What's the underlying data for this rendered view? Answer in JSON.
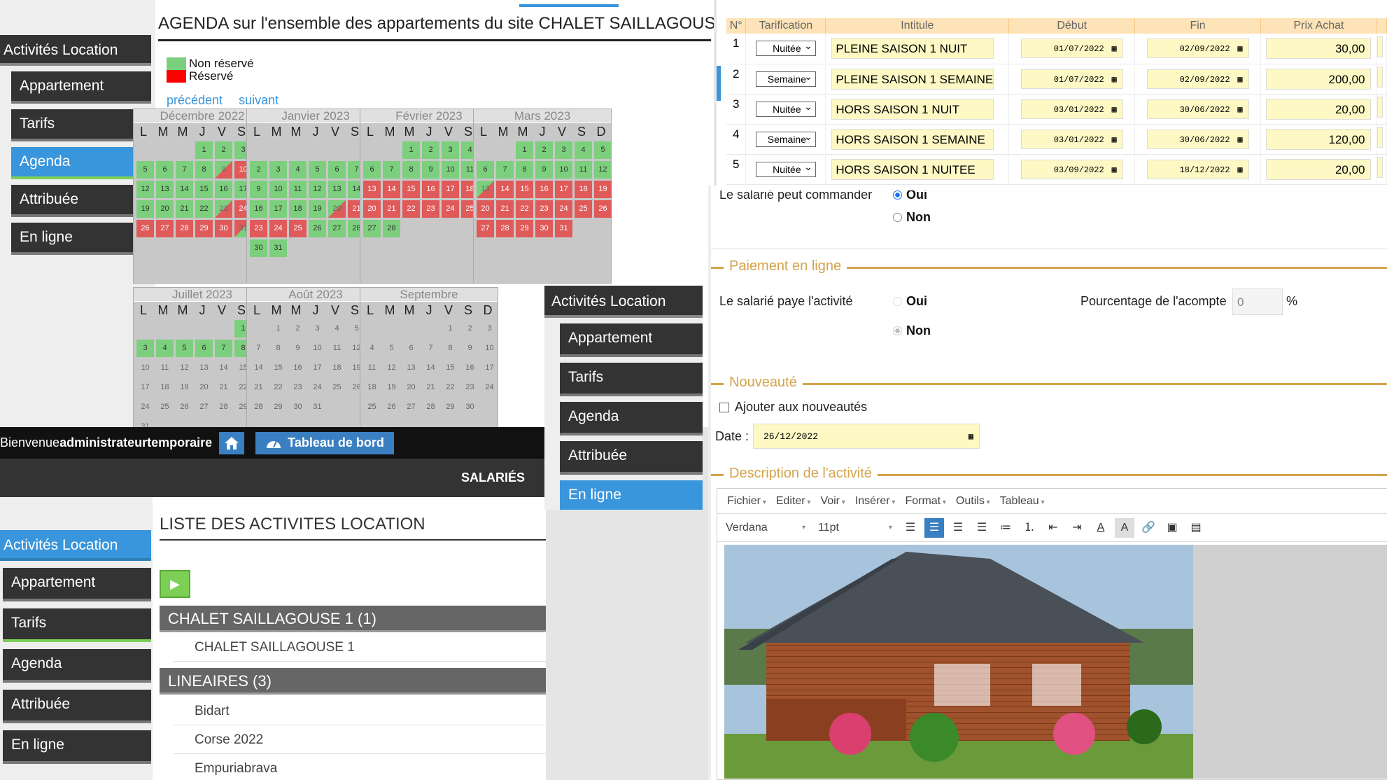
{
  "agenda": {
    "title": "AGENDA sur l'ensemble des appartements du site CHALET SAILLAGOUSE 1",
    "legend_free": "Non réservé",
    "legend_booked": "Réservé",
    "prev": "précédent",
    "next": "suivant",
    "colors": {
      "free": "#7ccf7c",
      "booked": "#e05a5a",
      "accent": "#3a96dc"
    },
    "day_headers": [
      "L",
      "M",
      "M",
      "J",
      "V",
      "S",
      "D"
    ],
    "months": [
      {
        "name": "Décembre 2022"
      },
      {
        "name": "Janvier 2023"
      },
      {
        "name": "Février 2023"
      },
      {
        "name": "Mars 2023"
      },
      {
        "name": "Juillet 2023"
      },
      {
        "name": "Août 2023"
      },
      {
        "name": "Septembre"
      }
    ]
  },
  "nav1": {
    "header": "Activités Location",
    "items": [
      "Appartement",
      "Tarifs",
      "Agenda",
      "Attribuée",
      "En ligne"
    ]
  },
  "nav2": {
    "header": "Activités Location",
    "items": [
      "Appartement",
      "Tarifs",
      "Agenda",
      "Attribuée",
      "En ligne"
    ]
  },
  "nav3": {
    "header": "Activités Location",
    "items": [
      "Appartement",
      "Tarifs",
      "Agenda",
      "Attribuée",
      "En ligne"
    ]
  },
  "topbar": {
    "welcome": "Bienvenue ",
    "user": "administrateurtemporaire",
    "dashboard": "Tableau de bord",
    "section": "SALARIÉS"
  },
  "liste": {
    "title": "LISTE DES ACTIVITES LOCATION",
    "groups": [
      {
        "label": "CHALET SAILLAGOUSE 1 (1)",
        "items": [
          "CHALET SAILLAGOUSE 1"
        ]
      },
      {
        "label": "LINEAIRES (3)",
        "items": [
          "Bidart",
          "Corse 2022",
          "Empuriabrava"
        ]
      }
    ]
  },
  "tarifs": {
    "headers": [
      "N°",
      "Tarification",
      "Intitule",
      "Début",
      "Fin",
      "Prix Achat"
    ],
    "rows": [
      {
        "n": "1",
        "type": "Nuitée",
        "label": "PLEINE SAISON 1 NUIT",
        "start": "01/07/2022",
        "end": "02/09/2022",
        "price": "30,00"
      },
      {
        "n": "2",
        "type": "Semaine",
        "label": "PLEINE SAISON 1 SEMAINE",
        "start": "01/07/2022",
        "end": "02/09/2022",
        "price": "200,00"
      },
      {
        "n": "3",
        "type": "Nuitée",
        "label": "HORS SAISON 1 NUIT",
        "start": "03/01/2022",
        "end": "30/06/2022",
        "price": "20,00"
      },
      {
        "n": "4",
        "type": "Semaine",
        "label": "HORS SAISON 1 SEMAINE",
        "start": "03/01/2022",
        "end": "30/06/2022",
        "price": "120,00"
      },
      {
        "n": "5",
        "type": "Nuitée",
        "label": "HORS SAISON 1 NUITEE",
        "start": "03/09/2022",
        "end": "18/12/2022",
        "price": "20,00"
      }
    ]
  },
  "form": {
    "can_order": "Le salarié peut commander",
    "yes": "Oui",
    "no": "Non",
    "payment_legend": "Paiement en ligne",
    "pays": "Le salarié paye l'activité",
    "deposit_label": "Pourcentage de l'acompte",
    "deposit_value": "0",
    "percent": "%",
    "news_legend": "Nouveauté",
    "add_news": "Ajouter aux nouveautés",
    "date_label": "Date :",
    "date_value": "26/12/2022",
    "desc_legend": "Description de l'activité",
    "menus": [
      "Fichier",
      "Editer",
      "Voir",
      "Insérer",
      "Format",
      "Outils",
      "Tableau"
    ],
    "font": "Verdana",
    "size": "11pt"
  }
}
